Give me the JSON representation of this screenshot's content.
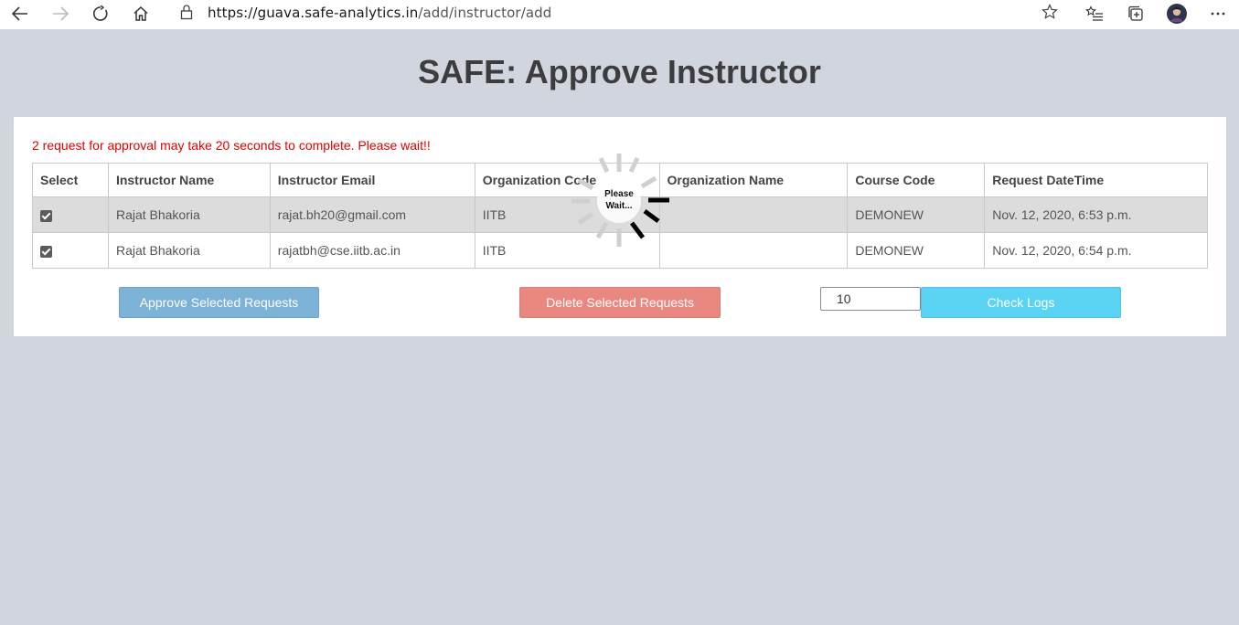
{
  "browser": {
    "url_host": "https://guava.safe-analytics.in",
    "url_path": "/add/instructor/add"
  },
  "page": {
    "title": "SAFE: Approve Instructor",
    "notice": "2 request for approval may take 20 seconds to complete. Please wait!!",
    "notice_color": "#e00000"
  },
  "table": {
    "headers": [
      "Select",
      "Instructor Name",
      "Instructor Email",
      "Organization Code",
      "Organization Name",
      "Course Code",
      "Request DateTime"
    ],
    "rows": [
      {
        "selected": true,
        "name": "Rajat Bhakoria",
        "email": "rajat.bh20@gmail.com",
        "org_code": "IITB",
        "org_name": "",
        "course_code": "DEMONEW",
        "datetime": "Nov. 12, 2020, 6:53 p.m."
      },
      {
        "selected": true,
        "name": "Rajat Bhakoria",
        "email": "rajatbh@cse.iitb.ac.in",
        "org_code": "IITB",
        "org_name": "",
        "course_code": "DEMONEW",
        "datetime": "Nov. 12, 2020, 6:54 p.m."
      }
    ]
  },
  "actions": {
    "approve_label": "Approve Selected Requests",
    "delete_label": "Delete Selected Requests",
    "logs_count": "10",
    "logs_label": "Check Logs"
  },
  "spinner": {
    "line1": "Please",
    "line2": "Wait..."
  },
  "colors": {
    "background": "#d1d5de",
    "approve": "#7cb2d6",
    "delete": "#e98880",
    "logs": "#5bd3f3"
  }
}
